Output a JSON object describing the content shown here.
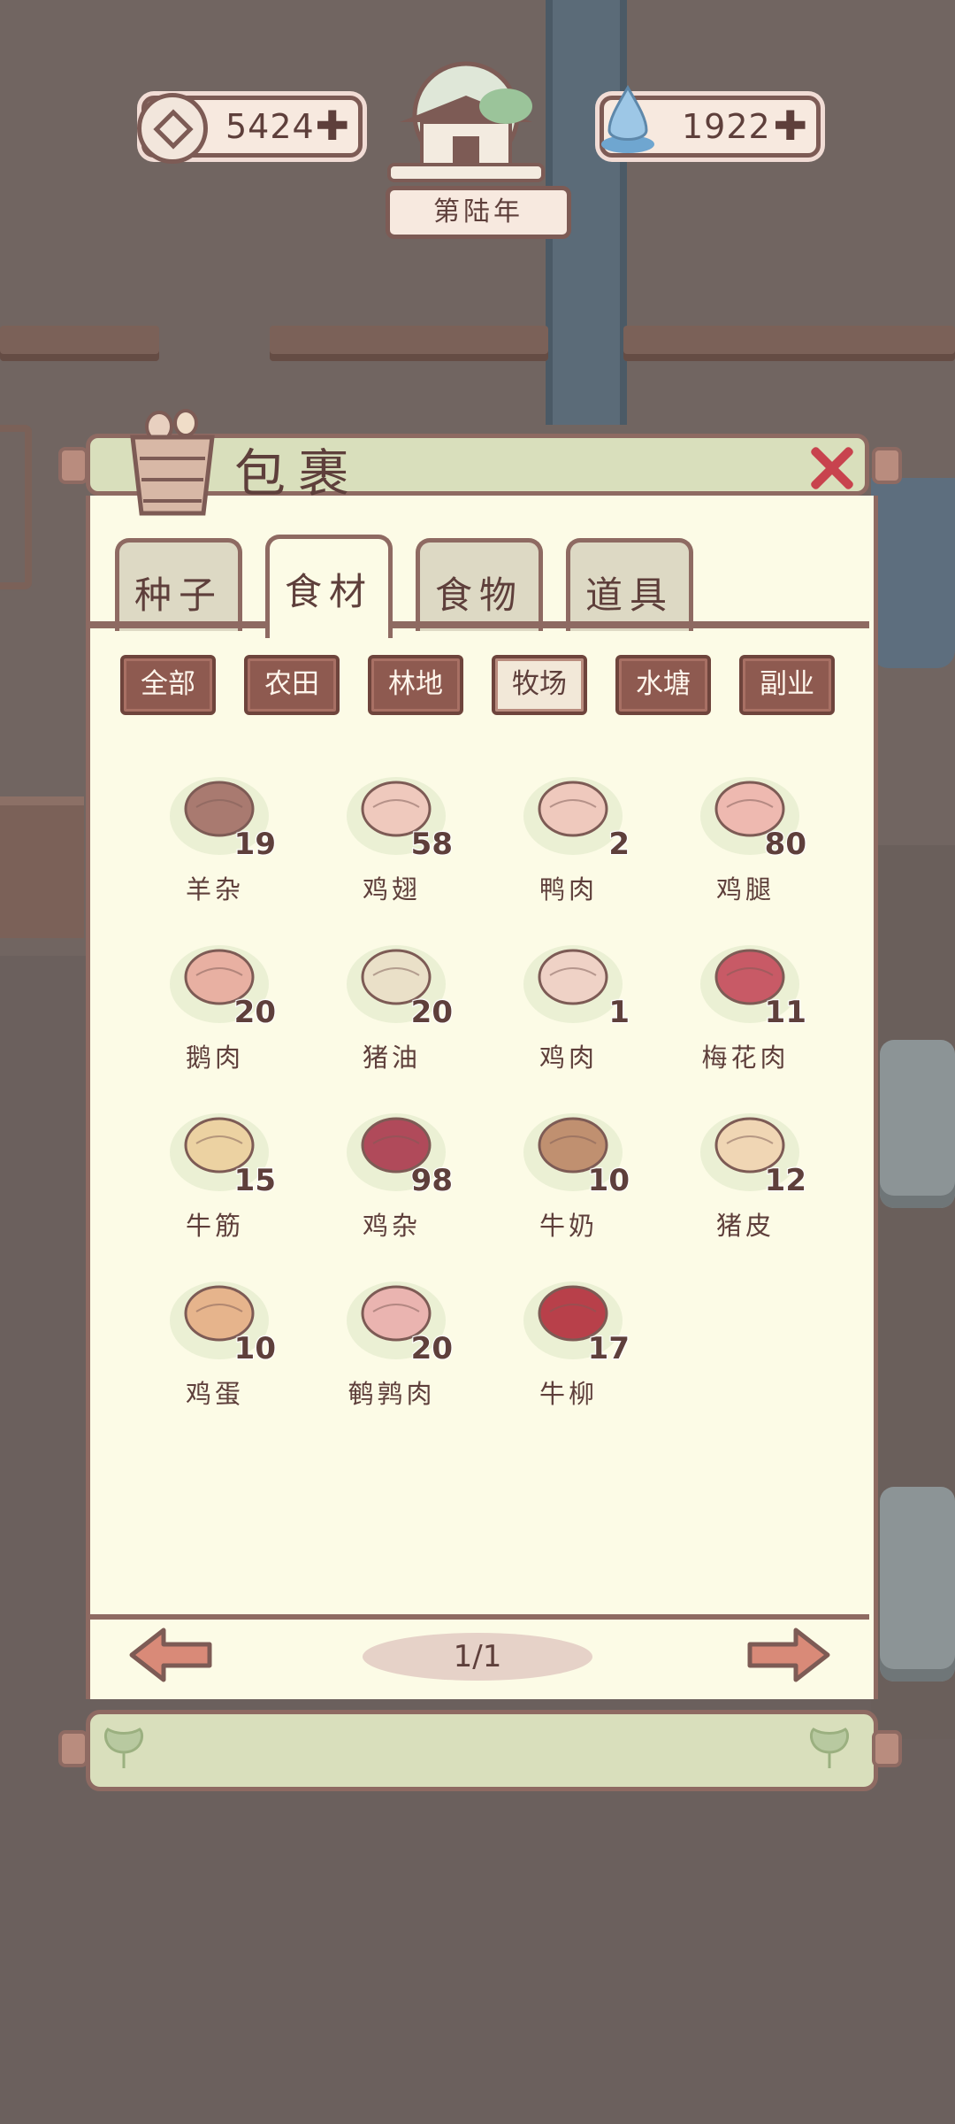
{
  "hud": {
    "coins": "5424",
    "water": "1922",
    "year": "第陆年"
  },
  "panel": {
    "title": "包裹",
    "tabs": [
      "种子",
      "食材",
      "食物",
      "道具"
    ],
    "active_tab": 1,
    "filters": [
      "全部",
      "农田",
      "林地",
      "牧场",
      "水塘",
      "副业"
    ],
    "active_filter": 3
  },
  "items": [
    {
      "name": "羊杂",
      "qty": "19",
      "icon": "lamb-offal-icon",
      "color": "#a97a70"
    },
    {
      "name": "鸡翅",
      "qty": "58",
      "icon": "chicken-wing-icon",
      "color": "#efc9bd"
    },
    {
      "name": "鸭肉",
      "qty": "2",
      "icon": "duck-meat-icon",
      "color": "#efc9bd"
    },
    {
      "name": "鸡腿",
      "qty": "80",
      "icon": "drumstick-icon",
      "color": "#eeb9b0"
    },
    {
      "name": "鹅肉",
      "qty": "20",
      "icon": "goose-meat-icon",
      "color": "#e8b0a2"
    },
    {
      "name": "猪油",
      "qty": "20",
      "icon": "lard-bowl-icon",
      "color": "#eae0c8"
    },
    {
      "name": "鸡肉",
      "qty": "1",
      "icon": "chicken-meat-icon",
      "color": "#efd2c6"
    },
    {
      "name": "梅花肉",
      "qty": "11",
      "icon": "pork-shoulder-icon",
      "color": "#c85a66"
    },
    {
      "name": "牛筋",
      "qty": "15",
      "icon": "beef-tendon-icon",
      "color": "#ecd2a2"
    },
    {
      "name": "鸡杂",
      "qty": "98",
      "icon": "chicken-giblets-icon",
      "color": "#b04a5a"
    },
    {
      "name": "牛奶",
      "qty": "10",
      "icon": "milk-bucket-icon",
      "color": "#c09070"
    },
    {
      "name": "猪皮",
      "qty": "12",
      "icon": "pork-skin-icon",
      "color": "#f0d6b4"
    },
    {
      "name": "鸡蛋",
      "qty": "10",
      "icon": "egg-icon",
      "color": "#e6b48c"
    },
    {
      "name": "鹌鹑肉",
      "qty": "20",
      "icon": "quail-meat-icon",
      "color": "#eab4b0"
    },
    {
      "name": "牛柳",
      "qty": "17",
      "icon": "beef-fillet-icon",
      "color": "#b8404a"
    }
  ],
  "pagination": {
    "page": "1/1"
  }
}
